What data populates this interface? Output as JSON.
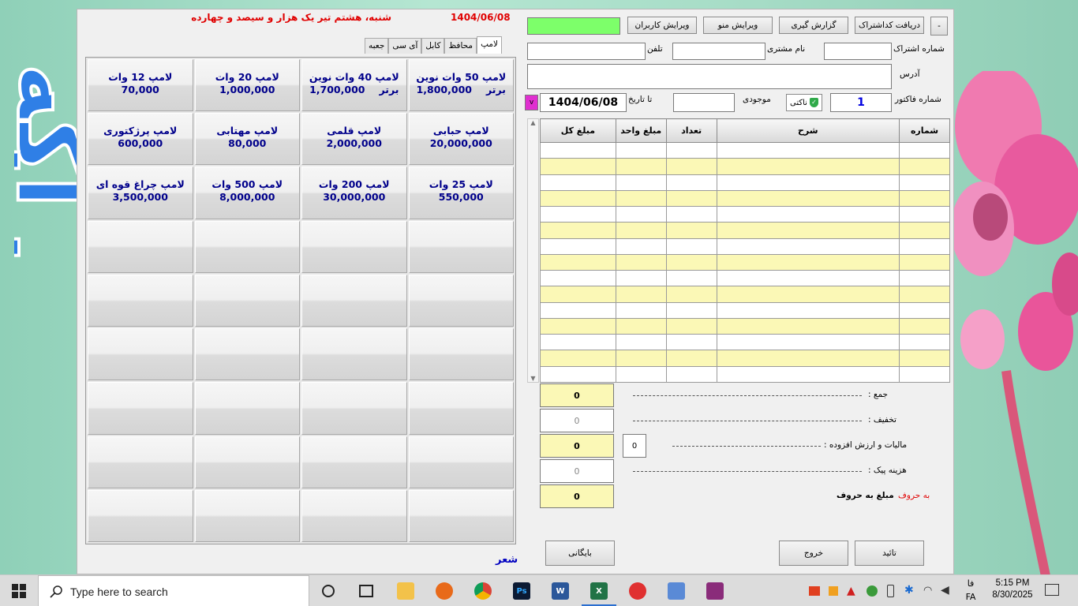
{
  "header": {
    "date": "1404/06/08",
    "date_text": "شنبه، هشتم تیر یک هزار و سیصد و چهارده"
  },
  "tabs": [
    "لامپ",
    "محافظ",
    "کابل",
    "آی سی",
    "جعبه"
  ],
  "tiles": [
    {
      "name": "لامپ 50 وات نوین",
      "sub": "برتر",
      "price": "1,800,000"
    },
    {
      "name": "لامپ 40 وات نوین",
      "sub": "برتر",
      "price": "1,700,000"
    },
    {
      "name": "لامپ 20 وات",
      "sub": "",
      "price": "1,000,000"
    },
    {
      "name": "لامپ 12 وات",
      "sub": "",
      "price": "70,000"
    },
    {
      "name": "لامپ حبابی",
      "sub": "",
      "price": "20,000,000"
    },
    {
      "name": "لامپ قلمی",
      "sub": "",
      "price": "2,000,000"
    },
    {
      "name": "لامپ مهتابی",
      "sub": "",
      "price": "80,000"
    },
    {
      "name": "لامپ پرژکتوری",
      "sub": "",
      "price": "600,000"
    },
    {
      "name": "لامپ 25 وات",
      "sub": "",
      "price": "550,000"
    },
    {
      "name": "لامپ 200 وات",
      "sub": "",
      "price": "30,000,000"
    },
    {
      "name": "لامپ 500 وات",
      "sub": "",
      "price": "8,000,000"
    },
    {
      "name": "لامپ چراغ قوه ای",
      "sub": "",
      "price": "3,500,000"
    }
  ],
  "toolbar": {
    "minus": "-",
    "receive": "دریافت کداشتراک",
    "report": "گزارش گیری",
    "edit_menu": "ویرایش منو",
    "edit_users": "ویرایش کاربران"
  },
  "form": {
    "subscription_label": "شماره اشتراک",
    "customer_label": "نام مشتری",
    "phone_label": "تلفن",
    "address_label": "آدرس",
    "invoice_label": "شماره فاکتور",
    "invoice_value": "1",
    "stock_label": "موجودی",
    "stock_button": "ناکتی",
    "to_date_label": "تا تاریخ",
    "to_date_value": "1404/06/08",
    "dropdown_glyph": "v"
  },
  "table": {
    "headers": [
      "شماره",
      "شرح",
      "تعداد",
      "مبلغ واحد",
      "مبلغ کل"
    ]
  },
  "summary": {
    "sum_label": "جمع :",
    "sum_value": "0",
    "discount_label": "تخفیف :",
    "discount_value": "0",
    "tax_label": "مالیات و ارزش افزوده :",
    "tax_value": "0",
    "tax_percent": "0",
    "delivery_label": "هزینه پیک :",
    "delivery_value": "0",
    "total_value": "0",
    "words_prefix": "به حروف",
    "words_label": "مبلغ به حروف"
  },
  "buttons": {
    "confirm": "تائید",
    "exit": "خروج",
    "archive": "بایگانی"
  },
  "footer_link": "شعر",
  "background_text": "آگه سازان",
  "taskbar": {
    "search_placeholder": "Type here to search",
    "time": "5:15 PM",
    "date": "8/30/2025",
    "lang_top": "فا",
    "lang_bottom": "FA"
  },
  "colors": {
    "accent_red": "#e00000",
    "tile_text": "#00008b",
    "row_yellow": "#fbf8b6",
    "status_green": "#7dff6a"
  }
}
